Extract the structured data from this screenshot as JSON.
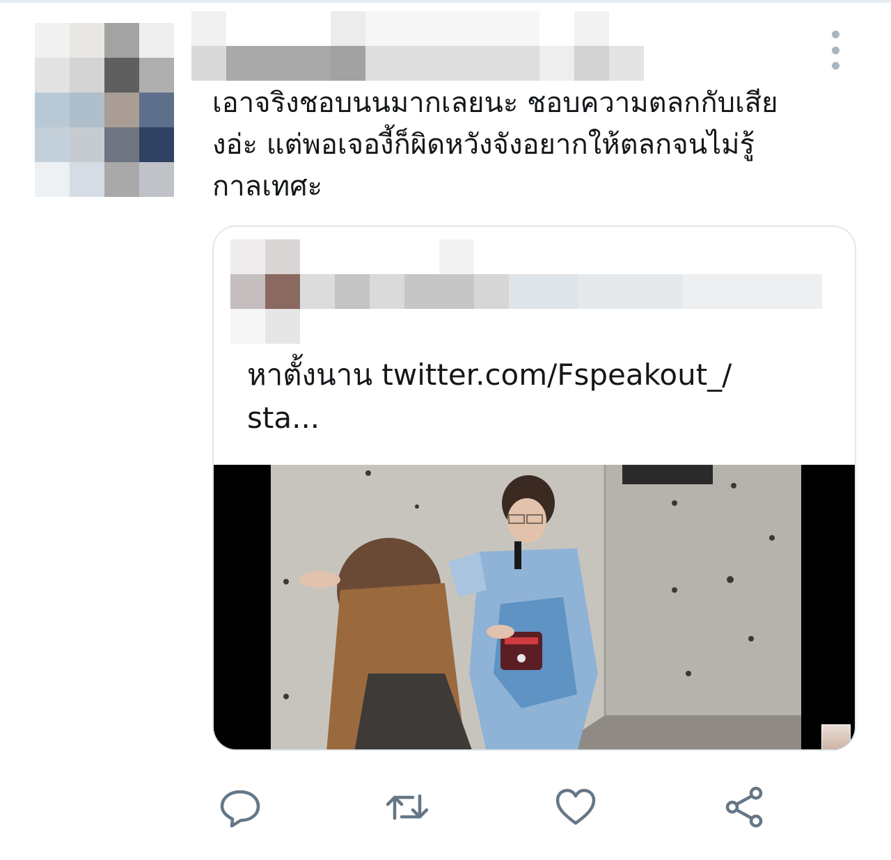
{
  "tweet": {
    "text": "เอาจริงชอบนนมากเลยนะ ชอบความตลกกับเสียงอ่ะ แต่พอเจองี้ก็ผิดหวังจังอยากให้ตลกจนไม่รู้กาลเทศะ",
    "lines": [
      "เอาจริงชอบนนมากเลยนะ ชอบความตลกกับเสีย",
      "งอ่ะ แต่พอเจองี้ก็ผิดหวังจังอยากให้ตลกจนไม่รู้",
      "กาลเทศะ"
    ]
  },
  "quote": {
    "text_prefix": "หาตั้งนาน ",
    "link_line1": "twitter.com/Fspeakout_/",
    "link_line2": "sta..."
  },
  "colors": {
    "icon": "#657786",
    "border": "#e1e8ed",
    "text": "#14171a",
    "more_dots": "#a8b6c2"
  },
  "icons": {
    "more": "vertical-ellipsis-icon",
    "reply": "speech-bubble-icon",
    "retweet": "retweet-icon",
    "like": "heart-icon",
    "share": "share-nodes-icon"
  }
}
